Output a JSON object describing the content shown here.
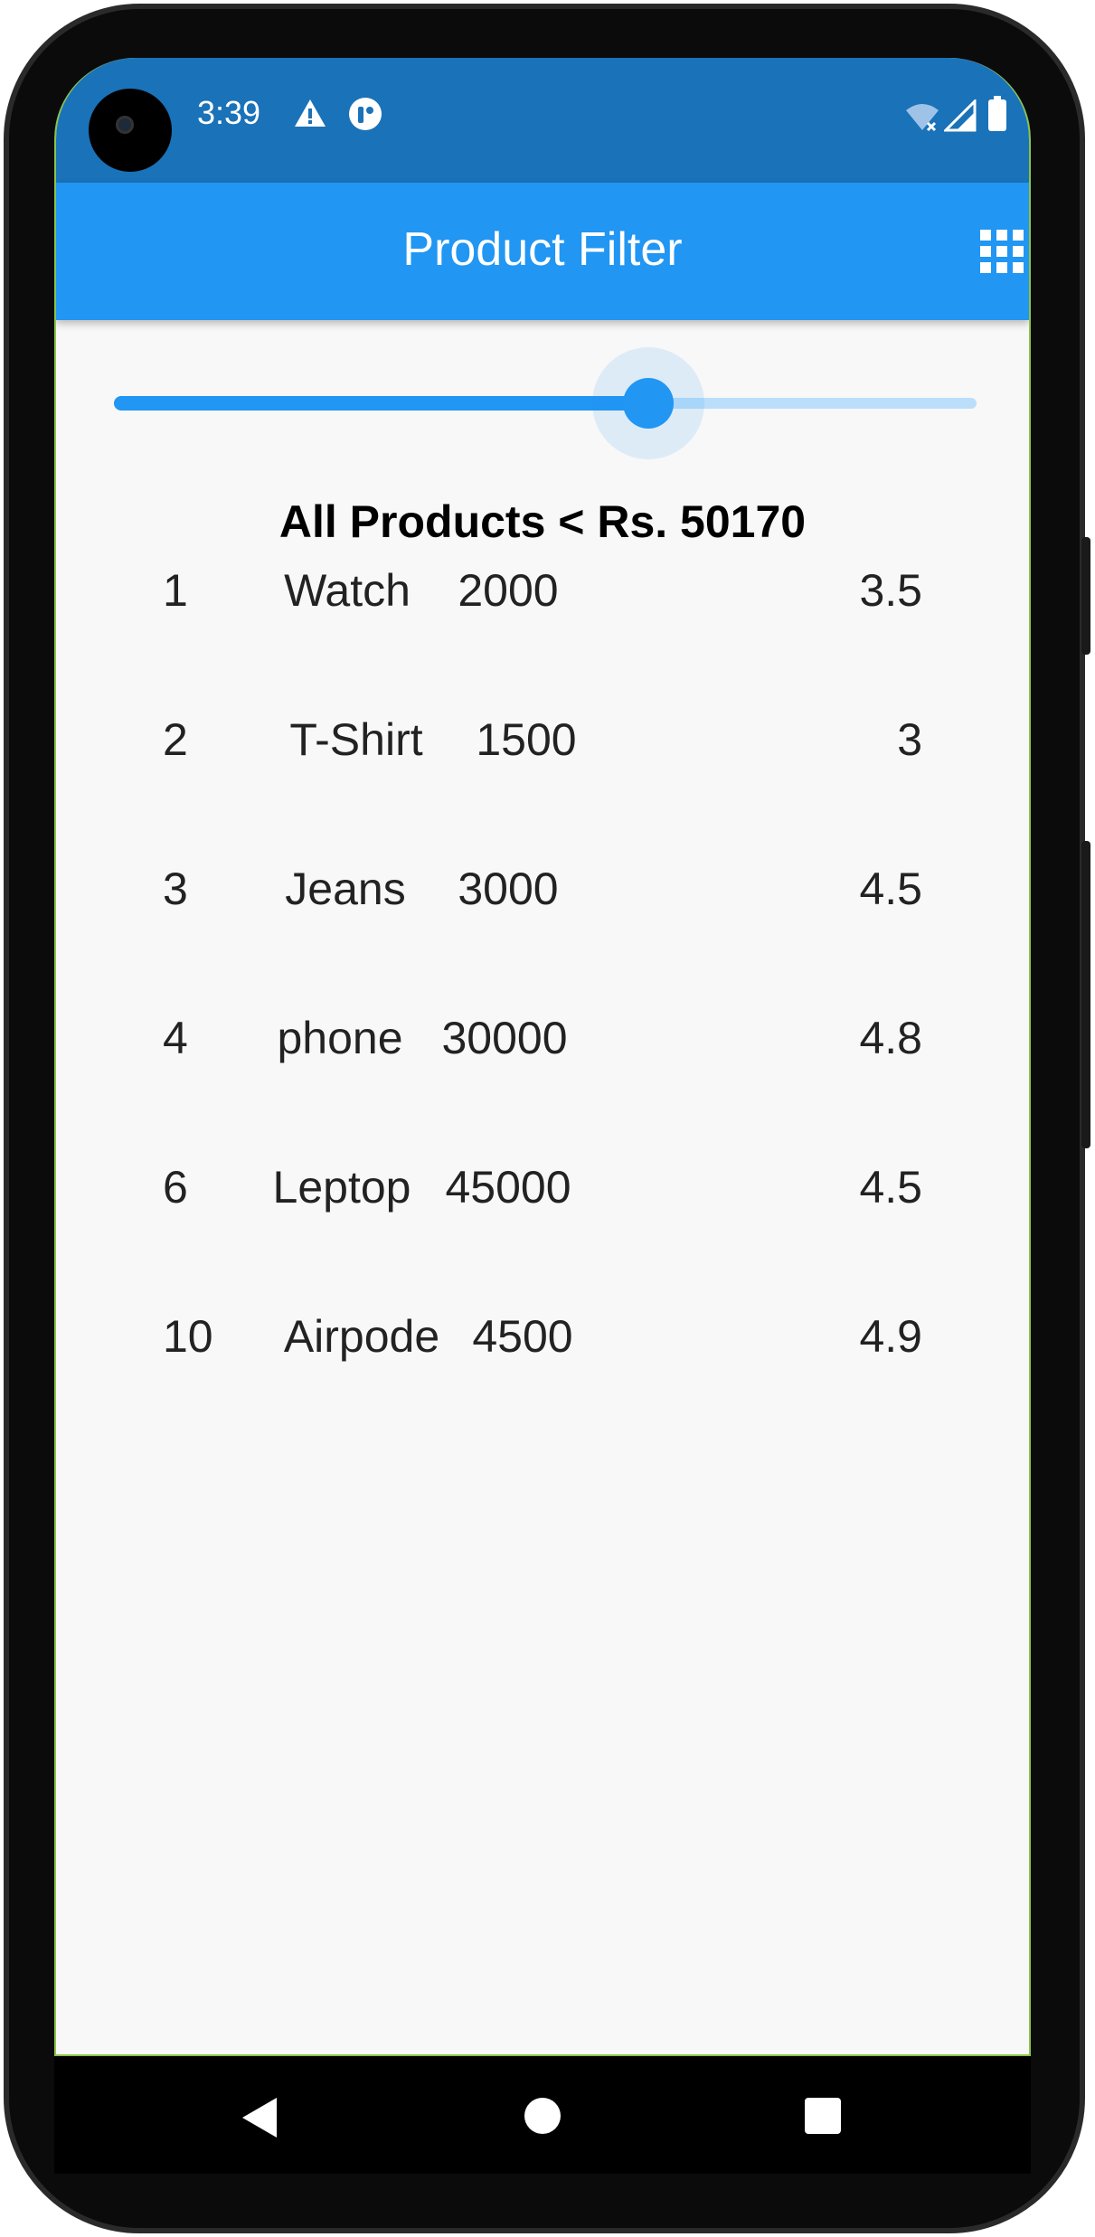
{
  "status_bar": {
    "time": "3:39",
    "icons": [
      "warning-icon",
      "app-notification-icon",
      "wifi-icon",
      "signal-icon",
      "battery-icon"
    ]
  },
  "app_bar": {
    "title": "Product Filter",
    "action_icon": "grid-icon"
  },
  "slider": {
    "fill_fraction": 0.62
  },
  "heading": "All Products < Rs. 50170",
  "products": [
    {
      "id": "1",
      "name": "Watch",
      "price": "2000",
      "rating": "3.5"
    },
    {
      "id": "2",
      "name": "T-Shirt",
      "price": "1500",
      "rating": "3"
    },
    {
      "id": "3",
      "name": "Jeans",
      "price": "3000",
      "rating": "4.5"
    },
    {
      "id": "4",
      "name": "phone",
      "price": "30000",
      "rating": "4.8"
    },
    {
      "id": "6",
      "name": "Leptop",
      "price": "45000",
      "rating": "4.5"
    },
    {
      "id": "10",
      "name": "Airpode",
      "price": "4500",
      "rating": "4.9"
    }
  ],
  "colors": {
    "status_bar": "#1a72b8",
    "app_bar": "#2196f3",
    "accent": "#2196f3",
    "background": "#f8f8f8"
  }
}
